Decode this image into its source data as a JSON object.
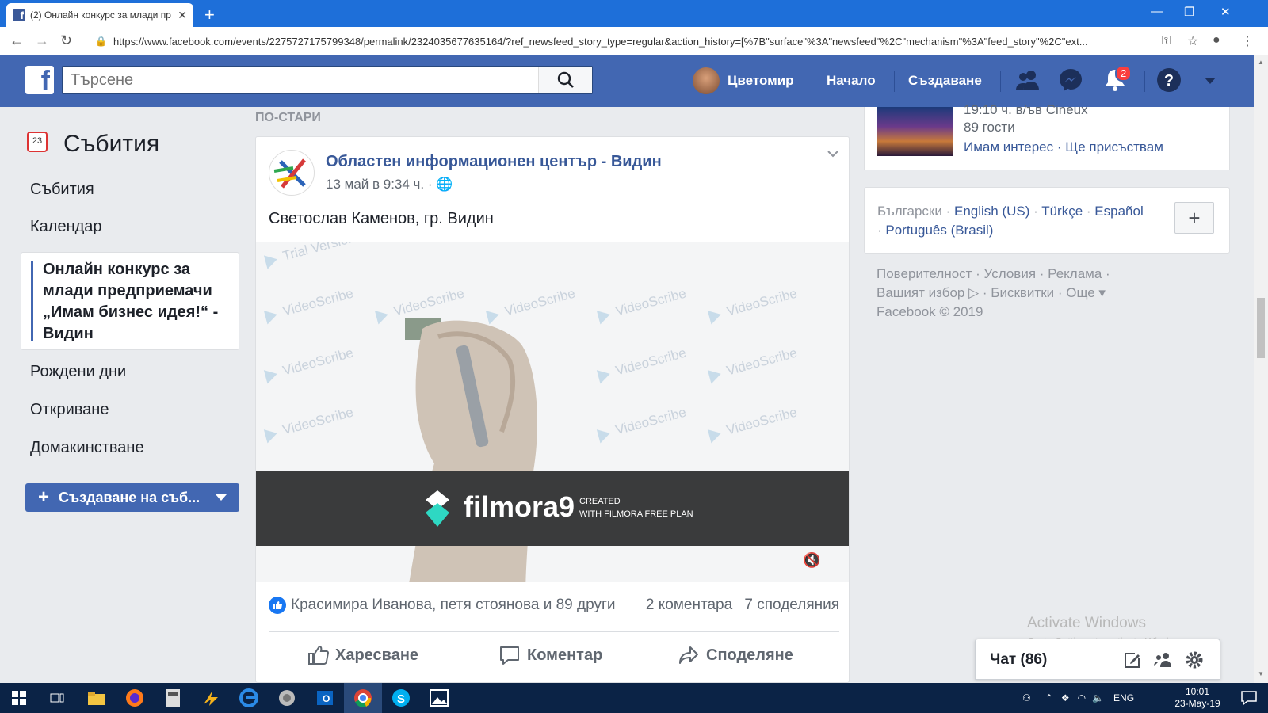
{
  "browser": {
    "tab_title": "(2) Онлайн конкурс за млади пр",
    "url": "https://www.facebook.com/events/2275727175799348/permalink/2324035677635164/?ref_newsfeed_story_type=regular&action_history=[%7B\"surface\"%3A\"newsfeed\"%2C\"mechanism\"%3A\"feed_story\"%2C\"ext..."
  },
  "header": {
    "search_placeholder": "Търсене",
    "user_name": "Цветомир",
    "home": "Начало",
    "create": "Създаване",
    "notifications_count": "2",
    "brand_color": "#4267b2"
  },
  "sidebar": {
    "title": "Събития",
    "calendar_day": "23",
    "items": [
      "Събития",
      "Календар",
      "Рождени дни",
      "Откриване",
      "Домакинстване"
    ],
    "active_item": "Онлайн конкурс за млади предприемачи „Имам бизнес идея!“ - Видин",
    "create_button": "Създаване на съб..."
  },
  "feed": {
    "section_label": "ПО-СТАРИ",
    "post": {
      "author": "Областен информационен център - Видин",
      "date": "13 май в 9:34 ч. ·",
      "text": "Светослав Каменов, гр. Видин",
      "video": {
        "watermark": "VideoScribe",
        "watermark_sub": "Trial Version",
        "brand": "filmora9",
        "brand_sub1": "CREATED",
        "brand_sub2": "WITH FILMORA FREE PLAN"
      },
      "reactions": "Красимира Иванова, петя стоянова и 89 други",
      "comments": "2 коментара",
      "shares": "7 споделяния",
      "actions": {
        "like": "Харесване",
        "comment": "Коментар",
        "share": "Споделяне"
      }
    }
  },
  "right": {
    "event_time": "19:10 ч. в/ъв Cineux",
    "event_guests": "89 гости",
    "interested": "Имам интерес",
    "going": "Ще присъствам",
    "languages": {
      "current": "Български",
      "others": [
        "English (US)",
        "Türkçe",
        "Español",
        "Português (Brasil)"
      ]
    },
    "footer_line1": "Поверителност · Условия · Реклама ·",
    "footer_line2": "Вашият избор ▷ · Бисквитки · Още ▾",
    "footer_line3": "Facebook © 2019"
  },
  "chat": {
    "label": "Чат (86)"
  },
  "windows": {
    "activate_title": "Activate Windows",
    "activate_sub": "Go to Settings to activate Windows.",
    "lang": "ENG",
    "time": "10:01",
    "date": "23-May-19"
  }
}
